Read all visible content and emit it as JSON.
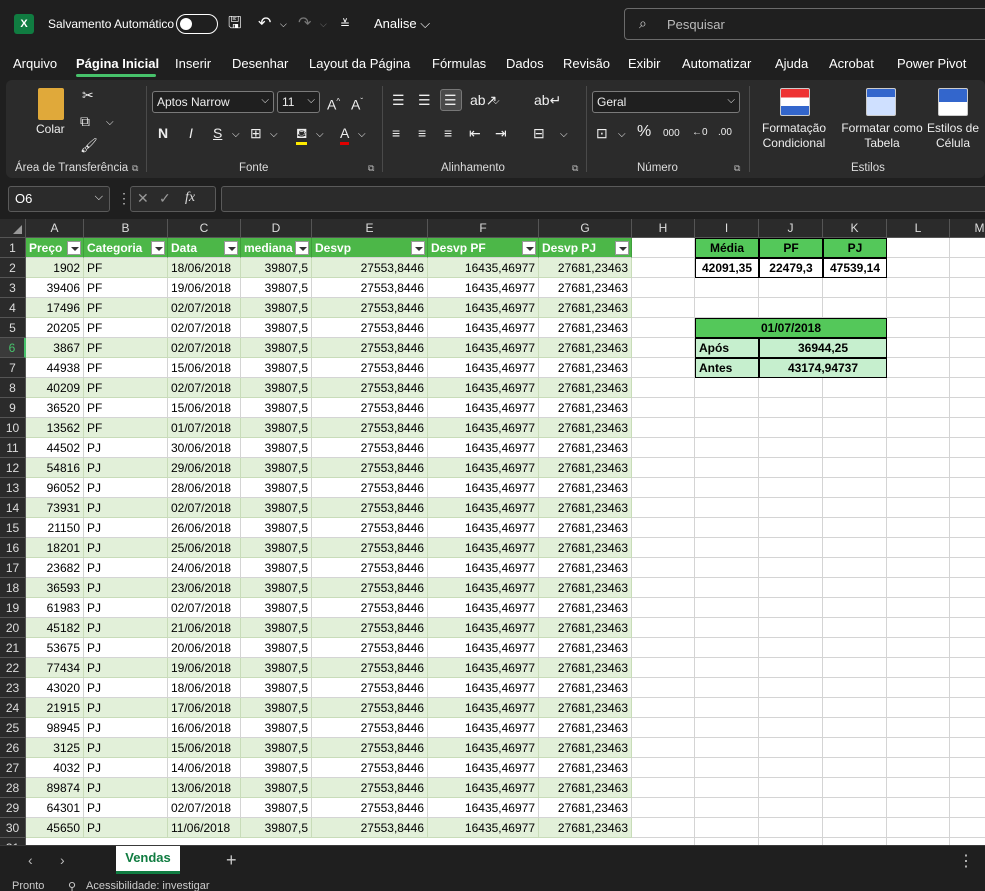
{
  "app": {
    "logo_letter": "X",
    "autosave_label": "Salvamento Automático",
    "document_name": "Analise ⌵",
    "search_placeholder": "Pesquisar"
  },
  "menu_tabs": [
    "Arquivo",
    "Página Inicial",
    "Inserir",
    "Desenhar",
    "Layout da Página",
    "Fórmulas",
    "Dados",
    "Revisão",
    "Exibir",
    "Automatizar",
    "Ajuda",
    "Acrobat",
    "Power Pivot"
  ],
  "active_tab": "Página Inicial",
  "ribbon": {
    "paste_label": "Colar",
    "font_name": "Aptos Narrow",
    "font_size": "11",
    "bold": "N",
    "italic": "I",
    "underline": "S",
    "number_format": "Geral",
    "conditional_formatting": "Formatação Condicional",
    "format_as_table": "Formatar como Tabela",
    "cell_styles": "Estilos de Célula",
    "groups": {
      "clipboard": "Área de Transferência",
      "font": "Fonte",
      "alignment": "Alinhamento",
      "number": "Número",
      "styles": "Estilos"
    }
  },
  "formula_bar": {
    "name_box": "O6",
    "fx_label": "fx",
    "formula": ""
  },
  "columns": [
    "A",
    "B",
    "C",
    "D",
    "E",
    "F",
    "G",
    "H",
    "I",
    "J",
    "K",
    "L",
    "M"
  ],
  "table": {
    "headers": [
      "Preço",
      "Categoria",
      "Data",
      "mediana",
      "Desvp",
      "Desvp  PF",
      "Desvp  PJ"
    ],
    "rows": [
      [
        "1902",
        "PF",
        "18/06/2018",
        "39807,5",
        "27553,8446",
        "16435,46977",
        "27681,23463"
      ],
      [
        "39406",
        "PF",
        "19/06/2018",
        "39807,5",
        "27553,8446",
        "16435,46977",
        "27681,23463"
      ],
      [
        "17496",
        "PF",
        "02/07/2018",
        "39807,5",
        "27553,8446",
        "16435,46977",
        "27681,23463"
      ],
      [
        "20205",
        "PF",
        "02/07/2018",
        "39807,5",
        "27553,8446",
        "16435,46977",
        "27681,23463"
      ],
      [
        "3867",
        "PF",
        "02/07/2018",
        "39807,5",
        "27553,8446",
        "16435,46977",
        "27681,23463"
      ],
      [
        "44938",
        "PF",
        "15/06/2018",
        "39807,5",
        "27553,8446",
        "16435,46977",
        "27681,23463"
      ],
      [
        "40209",
        "PF",
        "02/07/2018",
        "39807,5",
        "27553,8446",
        "16435,46977",
        "27681,23463"
      ],
      [
        "36520",
        "PF",
        "15/06/2018",
        "39807,5",
        "27553,8446",
        "16435,46977",
        "27681,23463"
      ],
      [
        "13562",
        "PF",
        "01/07/2018",
        "39807,5",
        "27553,8446",
        "16435,46977",
        "27681,23463"
      ],
      [
        "44502",
        "PJ",
        "30/06/2018",
        "39807,5",
        "27553,8446",
        "16435,46977",
        "27681,23463"
      ],
      [
        "54816",
        "PJ",
        "29/06/2018",
        "39807,5",
        "27553,8446",
        "16435,46977",
        "27681,23463"
      ],
      [
        "96052",
        "PJ",
        "28/06/2018",
        "39807,5",
        "27553,8446",
        "16435,46977",
        "27681,23463"
      ],
      [
        "73931",
        "PJ",
        "02/07/2018",
        "39807,5",
        "27553,8446",
        "16435,46977",
        "27681,23463"
      ],
      [
        "21150",
        "PJ",
        "26/06/2018",
        "39807,5",
        "27553,8446",
        "16435,46977",
        "27681,23463"
      ],
      [
        "18201",
        "PJ",
        "25/06/2018",
        "39807,5",
        "27553,8446",
        "16435,46977",
        "27681,23463"
      ],
      [
        "23682",
        "PJ",
        "24/06/2018",
        "39807,5",
        "27553,8446",
        "16435,46977",
        "27681,23463"
      ],
      [
        "36593",
        "PJ",
        "23/06/2018",
        "39807,5",
        "27553,8446",
        "16435,46977",
        "27681,23463"
      ],
      [
        "61983",
        "PJ",
        "02/07/2018",
        "39807,5",
        "27553,8446",
        "16435,46977",
        "27681,23463"
      ],
      [
        "45182",
        "PJ",
        "21/06/2018",
        "39807,5",
        "27553,8446",
        "16435,46977",
        "27681,23463"
      ],
      [
        "53675",
        "PJ",
        "20/06/2018",
        "39807,5",
        "27553,8446",
        "16435,46977",
        "27681,23463"
      ],
      [
        "77434",
        "PJ",
        "19/06/2018",
        "39807,5",
        "27553,8446",
        "16435,46977",
        "27681,23463"
      ],
      [
        "43020",
        "PJ",
        "18/06/2018",
        "39807,5",
        "27553,8446",
        "16435,46977",
        "27681,23463"
      ],
      [
        "21915",
        "PJ",
        "17/06/2018",
        "39807,5",
        "27553,8446",
        "16435,46977",
        "27681,23463"
      ],
      [
        "98945",
        "PJ",
        "16/06/2018",
        "39807,5",
        "27553,8446",
        "16435,46977",
        "27681,23463"
      ],
      [
        "3125",
        "PJ",
        "15/06/2018",
        "39807,5",
        "27553,8446",
        "16435,46977",
        "27681,23463"
      ],
      [
        "4032",
        "PJ",
        "14/06/2018",
        "39807,5",
        "27553,8446",
        "16435,46977",
        "27681,23463"
      ],
      [
        "89874",
        "PJ",
        "13/06/2018",
        "39807,5",
        "27553,8446",
        "16435,46977",
        "27681,23463"
      ],
      [
        "64301",
        "PJ",
        "02/07/2018",
        "39807,5",
        "27553,8446",
        "16435,46977",
        "27681,23463"
      ],
      [
        "45650",
        "PJ",
        "11/06/2018",
        "39807,5",
        "27553,8446",
        "16435,46977",
        "27681,23463"
      ]
    ]
  },
  "summary": {
    "media_label": "Média",
    "pf_label": "PF",
    "pj_label": "PJ",
    "media_value": "42091,35",
    "pf_value": "22479,3",
    "pj_value": "47539,14",
    "date": "01/07/2018",
    "apos_label": "Após",
    "apos_value": "36944,25",
    "antes_label": "Antes",
    "antes_value": "43174,94737"
  },
  "sheet_tab": "Vendas",
  "status": {
    "ready": "Pronto",
    "accessibility": "Acessibilidade: investigar"
  },
  "colors": {
    "accent": "#47c26b",
    "header_green": "#4cb748",
    "band_green": "#e2f0d9"
  }
}
